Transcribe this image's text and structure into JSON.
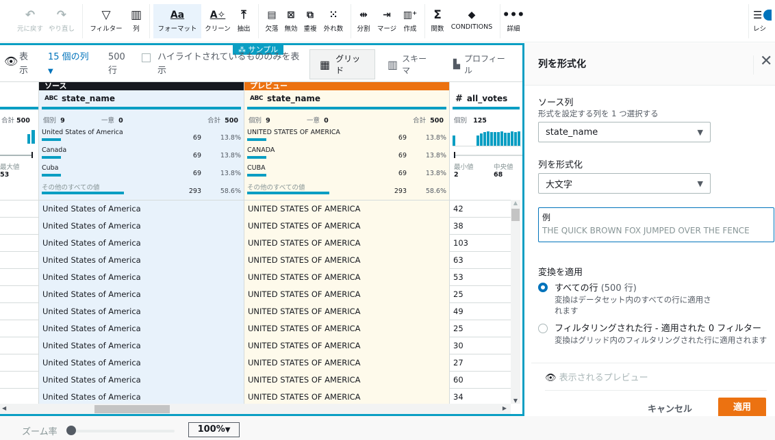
{
  "toolbar": {
    "undo": "元に戻す",
    "redo": "やり直し",
    "filter": "フィルター",
    "column": "列",
    "format": "フォーマット",
    "clean": "クリーン",
    "extract": "抽出",
    "missing": "欠落",
    "invalid": "無効",
    "duplicate": "重複",
    "outliers": "外れ数",
    "split": "分割",
    "merge": "マージ",
    "create": "作成",
    "functions": "関数",
    "conditions": "CONDITIONS",
    "details": "詳細",
    "recipe": "レシ"
  },
  "grid_toolbar": {
    "sample_tag": "サンプル",
    "show_label": "表示",
    "columns_count": "15 個の列",
    "rows_count": "500 行",
    "highlight_label": "ハイライトされているもののみを表示",
    "view_grid": "グリッド",
    "view_schema": "スキーマ",
    "view_profile": "プロフィール"
  },
  "columns": {
    "left_partial": {
      "total_label": "合計",
      "total_value": "500",
      "max_label": "最大値",
      "max_value": "53"
    },
    "source": {
      "band": "ソース",
      "name": "state_name",
      "type_icon": "ABC",
      "distinct_label": "個別",
      "distinct_value": "9",
      "unique_label": "一意",
      "unique_value": "0",
      "total_label": "合計",
      "total_value": "500",
      "top_values": [
        {
          "label": "United States of America",
          "count": "69",
          "pct": "13.8%",
          "fraction": 0.138
        },
        {
          "label": "Canada",
          "count": "69",
          "pct": "13.8%",
          "fraction": 0.138
        },
        {
          "label": "Cuba",
          "count": "69",
          "pct": "13.8%",
          "fraction": 0.138
        },
        {
          "label": "その他のすべての値",
          "count": "293",
          "pct": "58.6%",
          "fraction": 0.586
        }
      ]
    },
    "preview": {
      "band": "プレビュー",
      "name": "state_name",
      "type_icon": "ABC",
      "distinct_label": "個別",
      "distinct_value": "9",
      "unique_label": "一意",
      "unique_value": "0",
      "total_label": "合計",
      "total_value": "500",
      "top_values": [
        {
          "label": "UNITED STATES OF AMERICA",
          "count": "69",
          "pct": "13.8%",
          "fraction": 0.138
        },
        {
          "label": "CANADA",
          "count": "69",
          "pct": "13.8%",
          "fraction": 0.138
        },
        {
          "label": "CUBA",
          "count": "69",
          "pct": "13.8%",
          "fraction": 0.138
        },
        {
          "label": "その他のすべての値",
          "count": "293",
          "pct": "58.6%",
          "fraction": 0.586
        }
      ]
    },
    "all_votes": {
      "name": "all_votes",
      "type_icon": "#",
      "distinct_label": "個別",
      "distinct_value": "125",
      "min_label": "最小値",
      "min_value": "2",
      "median_label": "中央値",
      "median_value": "68"
    }
  },
  "rows": [
    {
      "source": "United States of America",
      "preview": "UNITED STATES OF AMERICA",
      "votes": "42"
    },
    {
      "source": "United States of America",
      "preview": "UNITED STATES OF AMERICA",
      "votes": "38"
    },
    {
      "source": "United States of America",
      "preview": "UNITED STATES OF AMERICA",
      "votes": "103"
    },
    {
      "source": "United States of America",
      "preview": "UNITED STATES OF AMERICA",
      "votes": "63"
    },
    {
      "source": "United States of America",
      "preview": "UNITED STATES OF AMERICA",
      "votes": "53"
    },
    {
      "source": "United States of America",
      "preview": "UNITED STATES OF AMERICA",
      "votes": "25"
    },
    {
      "source": "United States of America",
      "preview": "UNITED STATES OF AMERICA",
      "votes": "49"
    },
    {
      "source": "United States of America",
      "preview": "UNITED STATES OF AMERICA",
      "votes": "25"
    },
    {
      "source": "United States of America",
      "preview": "UNITED STATES OF AMERICA",
      "votes": "30"
    },
    {
      "source": "United States of America",
      "preview": "UNITED STATES OF AMERICA",
      "votes": "27"
    },
    {
      "source": "United States of America",
      "preview": "UNITED STATES OF AMERICA",
      "votes": "60"
    },
    {
      "source": "United States of America",
      "preview": "UNITED STATES OF AMERICA",
      "votes": "34"
    }
  ],
  "panel": {
    "title": "列を形式化",
    "source_col_label": "ソース列",
    "source_col_hint": "形式を設定する列を 1 つ選択する",
    "source_col_value": "state_name",
    "format_label": "列を形式化",
    "format_value": "大文字",
    "example_label": "例",
    "example_text": "THE QUICK BROWN FOX JUMPED OVER THE FENCE",
    "apply_label": "変換を適用",
    "opt_all": "すべての行",
    "opt_all_count": "(500 行)",
    "opt_all_desc": "変換はデータセット内のすべての行に適用されます",
    "opt_filtered": "フィルタリングされた行 - 適用された 0 フィルター",
    "opt_filtered_desc": "変換はグリッド内のフィルタリングされた行に適用されます",
    "preview_label": "表示されるプレビュー",
    "cancel": "キャンセル",
    "apply": "適用"
  },
  "footer": {
    "zoom_label": "ズーム率",
    "zoom_value": "100%"
  },
  "colors": {
    "accent": "#0a9ec3",
    "preview_band": "#ec7211",
    "source_band": "#16191f",
    "apply_btn": "#ec7211"
  }
}
